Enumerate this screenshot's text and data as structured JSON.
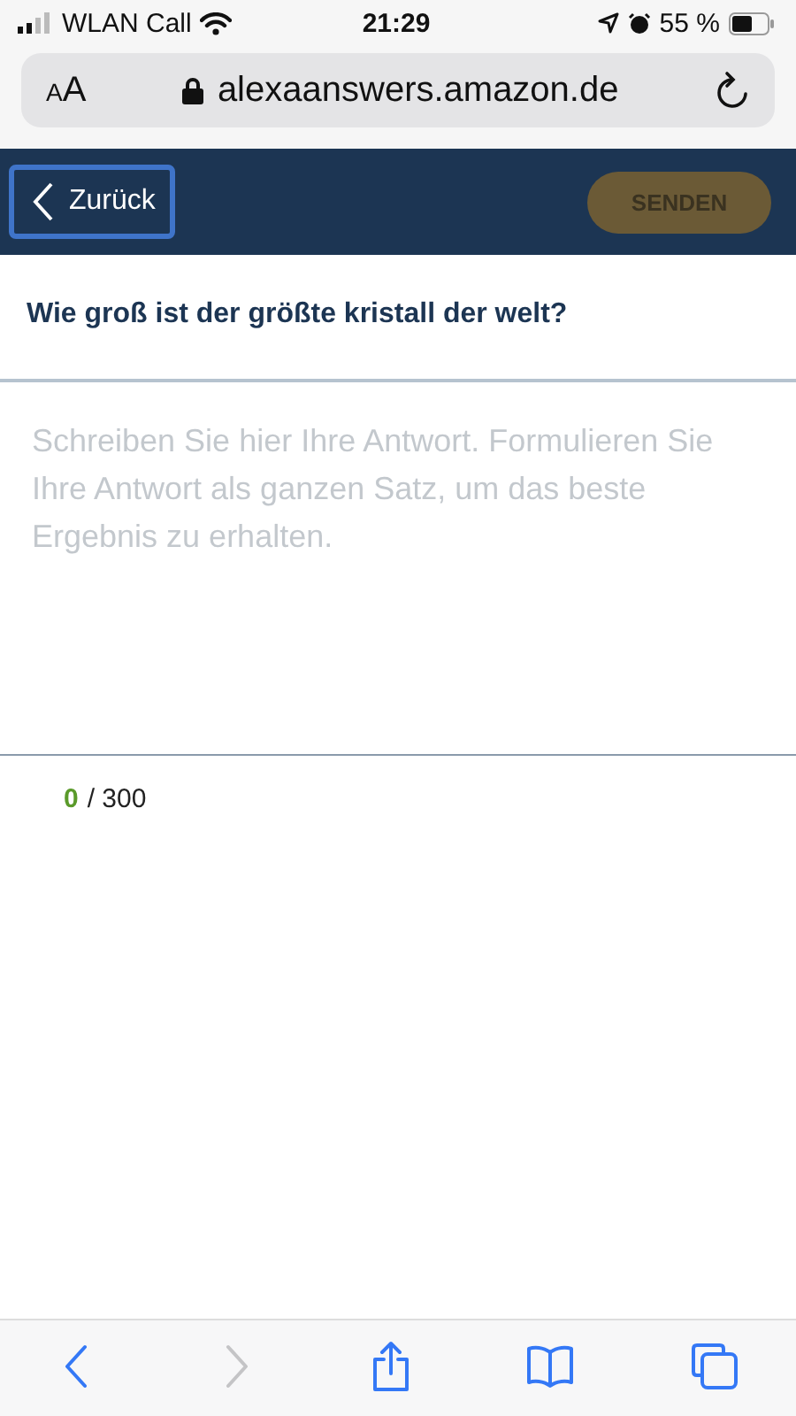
{
  "status_bar": {
    "carrier": "WLAN Call",
    "time": "21:29",
    "battery": "55 %"
  },
  "url_bar": {
    "text_size": "AA",
    "url": "alexaanswers.amazon.de"
  },
  "header": {
    "back_button": {
      "label": "Zurück",
      "focused": true
    },
    "send_button": {
      "label": "SENDEN",
      "disabled": true
    }
  },
  "question": "Wie groß ist der größte kristall der welt?",
  "answer": {
    "placeholder": "Schreiben Sie hier Ihre Antwort. Formulieren Sie Ihre Antwort als ganzen Satz, um das beste Ergebnis zu erhalten."
  },
  "counter": {
    "count": "0",
    "limit": "/ 300"
  },
  "toolbar": [
    {
      "kind": "back",
      "disabled": false
    },
    {
      "kind": "forward",
      "disabled": true
    },
    {
      "kind": "share",
      "disabled": false
    },
    {
      "kind": "bookmarks",
      "disabled": false
    },
    {
      "kind": "tabs",
      "disabled": false
    }
  ]
}
